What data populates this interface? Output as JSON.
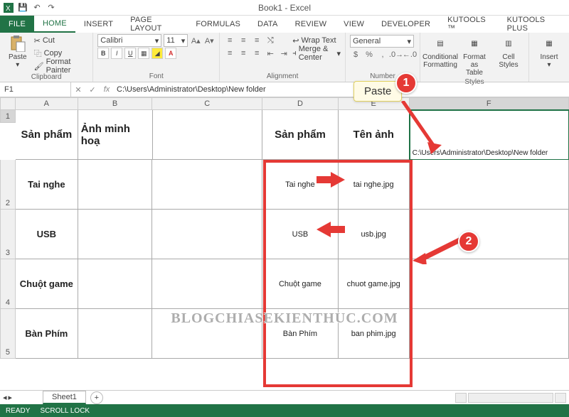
{
  "title": "Book1 - Excel",
  "tabs": [
    "FILE",
    "HOME",
    "INSERT",
    "PAGE LAYOUT",
    "FORMULAS",
    "DATA",
    "REVIEW",
    "VIEW",
    "DEVELOPER",
    "KUTOOLS ™",
    "KUTOOLS PLUS"
  ],
  "active_tab": "HOME",
  "ribbon": {
    "clipboard": {
      "label": "Clipboard",
      "paste": "Paste",
      "cut": "Cut",
      "copy": "Copy",
      "painter": "Format Painter"
    },
    "font": {
      "label": "Font",
      "name": "Calibri",
      "size": "11"
    },
    "alignment": {
      "label": "Alignment",
      "wrap": "Wrap Text",
      "merge": "Merge & Center"
    },
    "number": {
      "label": "Number",
      "format": "General"
    },
    "styles": {
      "label": "Styles",
      "cond": "Conditional\nFormatting",
      "table": "Format as\nTable",
      "cell": "Cell\nStyles"
    },
    "cells": {
      "label": "",
      "insert": "Insert"
    }
  },
  "namebox": "F1",
  "formula": "C:\\Users\\Administrator\\Desktop\\New folder",
  "columns": [
    "A",
    "B",
    "C",
    "D",
    "E",
    "F"
  ],
  "rownums": [
    "1",
    "2",
    "3",
    "4",
    "5"
  ],
  "data": {
    "r1": {
      "a": "Sản phẩm",
      "b": "Ảnh minh hoạ",
      "d": "Sản phẩm",
      "e": "Tên ảnh",
      "f": "C:\\Users\\Administrator\\Desktop\\New folder"
    },
    "r2": {
      "a": "Tai nghe",
      "d": "Tai nghe",
      "e": "tai nghe.jpg"
    },
    "r3": {
      "a": "USB",
      "d": "USB",
      "e": "usb.jpg"
    },
    "r4": {
      "a": "Chuột game",
      "d": "Chuột game",
      "e": "chuot game.jpg"
    },
    "r5": {
      "a": "Bàn Phím",
      "d": "Bàn Phím",
      "e": "ban phim.jpg"
    }
  },
  "sheet": "Sheet1",
  "status": {
    "ready": "READY",
    "scroll": "SCROLL LOCK"
  },
  "annot": {
    "paste": "Paste",
    "one": "1",
    "two": "2"
  },
  "watermark": "BLOGCHIASEKIENTHUC.COM"
}
